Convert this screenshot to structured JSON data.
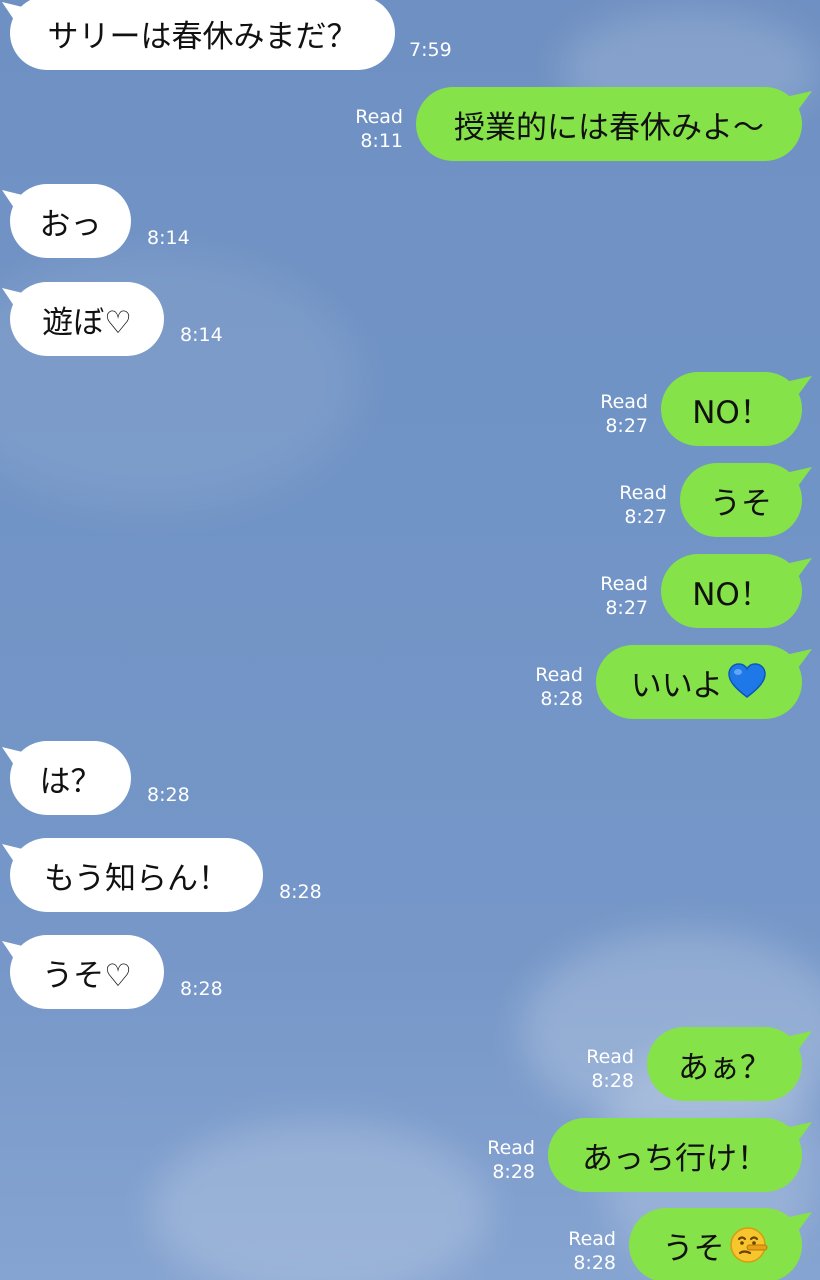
{
  "conversation": {
    "messages": [
      {
        "side": "in",
        "text": "サリーは春休みまだ？",
        "time": "7:59"
      },
      {
        "side": "out",
        "text": "授業的には春休みよ〜",
        "read": "Read",
        "time": "8:11"
      },
      {
        "side": "in",
        "text": "おっ",
        "time": "8:14"
      },
      {
        "side": "in",
        "text": "遊ぼ♡",
        "time": "8:14"
      },
      {
        "side": "out",
        "text": "NO！",
        "read": "Read",
        "time": "8:27"
      },
      {
        "side": "out",
        "text": "うそ",
        "read": "Read",
        "time": "8:27"
      },
      {
        "side": "out",
        "text": "NO！",
        "read": "Read",
        "time": "8:27"
      },
      {
        "side": "out",
        "text": "いいよ",
        "emoji": "blue-heart-icon",
        "read": "Read",
        "time": "8:28"
      },
      {
        "side": "in",
        "text": "は？",
        "time": "8:28"
      },
      {
        "side": "in",
        "text": "もう知らん！",
        "time": "8:28"
      },
      {
        "side": "in",
        "text": "うそ♡",
        "time": "8:28"
      },
      {
        "side": "out",
        "text": "あぁ？",
        "read": "Read",
        "time": "8:28"
      },
      {
        "side": "out",
        "text": "あっち行け！",
        "read": "Read",
        "time": "8:28"
      },
      {
        "side": "out",
        "text": "うそ",
        "emoji": "lying-face-icon",
        "read": "Read",
        "time": "8:28"
      }
    ]
  },
  "colors": {
    "background": "#7194c6",
    "incoming_bubble": "#ffffff",
    "outgoing_bubble": "#85e249",
    "meta_text": "#ffffff"
  }
}
